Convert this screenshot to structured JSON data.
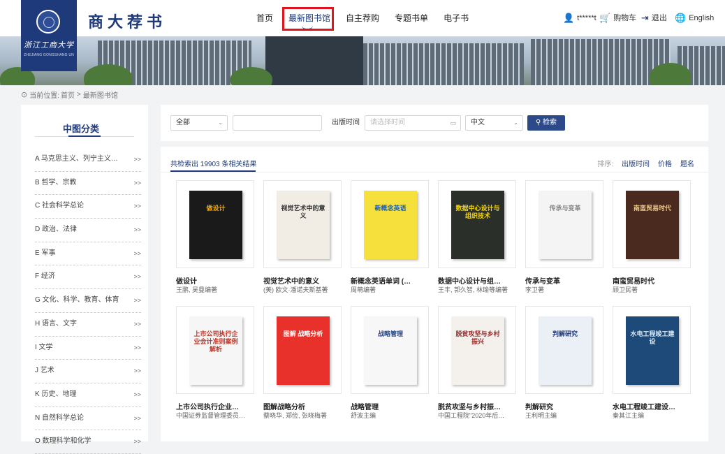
{
  "header": {
    "logo_script": "浙江工商大学",
    "logo_sub": "ZHEJIANG GONGSHANG UNIVERSITY",
    "brand": "商大荐书",
    "nav": [
      "首页",
      "最新图书馆",
      "自主荐购",
      "专题书单",
      "电子书"
    ],
    "active_nav": "最新图书馆",
    "user": "t*****t",
    "cart": "购物车",
    "logout": "退出",
    "language": "English"
  },
  "breadcrumb": {
    "label": "当前位置:",
    "home": "首页",
    "sep": ">",
    "current": "最新图书馆"
  },
  "sidebar": {
    "title": "中图分类",
    "items": [
      {
        "label": "A 马克思主义、列宁主义、…",
        "arrow": ">>"
      },
      {
        "label": "B 哲学、宗教",
        "arrow": ">>"
      },
      {
        "label": "C 社会科学总论",
        "arrow": ">>"
      },
      {
        "label": "D 政治、法律",
        "arrow": ">>"
      },
      {
        "label": "E 军事",
        "arrow": ">>"
      },
      {
        "label": "F 经济",
        "arrow": ">>"
      },
      {
        "label": "G 文化、科学、教育、体育",
        "arrow": ">>"
      },
      {
        "label": "H 语言、文字",
        "arrow": ">>"
      },
      {
        "label": "I 文学",
        "arrow": ">>"
      },
      {
        "label": "J 艺术",
        "arrow": ">>"
      },
      {
        "label": "K 历史、地理",
        "arrow": ">>"
      },
      {
        "label": "N 自然科学总论",
        "arrow": ">>"
      },
      {
        "label": "O 数理科学和化学",
        "arrow": ">>"
      }
    ]
  },
  "search": {
    "scope": "全部",
    "keyword_value": "",
    "date_label": "出版时间",
    "date_placeholder": "请选择时间",
    "language": "中文",
    "button": "检索"
  },
  "results": {
    "count_prefix": "共检索出",
    "count": "19903",
    "count_suffix": "条相关结果",
    "sort_label": "排序:",
    "sort_options": [
      "出版时间",
      "价格",
      "题名"
    ]
  },
  "books": [
    {
      "title": "做设计",
      "author": "王鹏, 吴曼编著",
      "cover_text": "做设计",
      "cover_bg": "#1a1a1a",
      "cover_fg": "#f2a900"
    },
    {
      "title": "视觉艺术中的意义",
      "author": "(美) 欧文·潘诺夫斯基著",
      "cover_text": "视觉艺术中的意义",
      "cover_bg": "#f1ede4",
      "cover_fg": "#333333"
    },
    {
      "title": "新概念英语单词 (…",
      "author": "周萌编著",
      "cover_text": "新概念英语",
      "cover_bg": "#f5e03c",
      "cover_fg": "#1b5fb0"
    },
    {
      "title": "数据中心设计与组…",
      "author": "王丰, 郭久智, 林瑜等编著",
      "cover_text": "数据中心设计与组织技术",
      "cover_bg": "#2b2f2a",
      "cover_fg": "#f4d400"
    },
    {
      "title": "传承与变革",
      "author": "李卫著",
      "cover_text": "传承与变革",
      "cover_bg": "#f4f4f4",
      "cover_fg": "#888888"
    },
    {
      "title": "南蛮贸易时代",
      "author": "顾卫民著",
      "cover_text": "南蛮贸易时代",
      "cover_bg": "#4a2a1e",
      "cover_fg": "#e8c48a"
    },
    {
      "title": "上市公司执行企业…",
      "author": "中国证券监督管理委员…",
      "cover_text": "上市公司执行企业会计准则案例解析",
      "cover_bg": "#f6f6f6",
      "cover_fg": "#c0392b"
    },
    {
      "title": "图解战略分析",
      "author": "蔡晓华, 郑俭, 张晓梅著",
      "cover_text": "图解 战略分析",
      "cover_bg": "#e8312a",
      "cover_fg": "#ffffff"
    },
    {
      "title": "战略管理",
      "author": "舒波主编",
      "cover_text": "战略管理",
      "cover_bg": "#f7f7f7",
      "cover_fg": "#2a4a8a"
    },
    {
      "title": "脱贫攻坚与乡村振…",
      "author": "中国工程院\"2020年后…",
      "cover_text": "脱贫攻坚与乡村振兴",
      "cover_bg": "#f4f1ec",
      "cover_fg": "#9a2a2a"
    },
    {
      "title": "判解研究",
      "author": "王利明主编",
      "cover_text": "判解研究",
      "cover_bg": "#eaf0f6",
      "cover_fg": "#1f3a7a"
    },
    {
      "title": "水电工程竣工建设…",
      "author": "秦其江主编",
      "cover_text": "水电工程竣工建设",
      "cover_bg": "#1e4a7a",
      "cover_fg": "#dbe8f4"
    }
  ]
}
